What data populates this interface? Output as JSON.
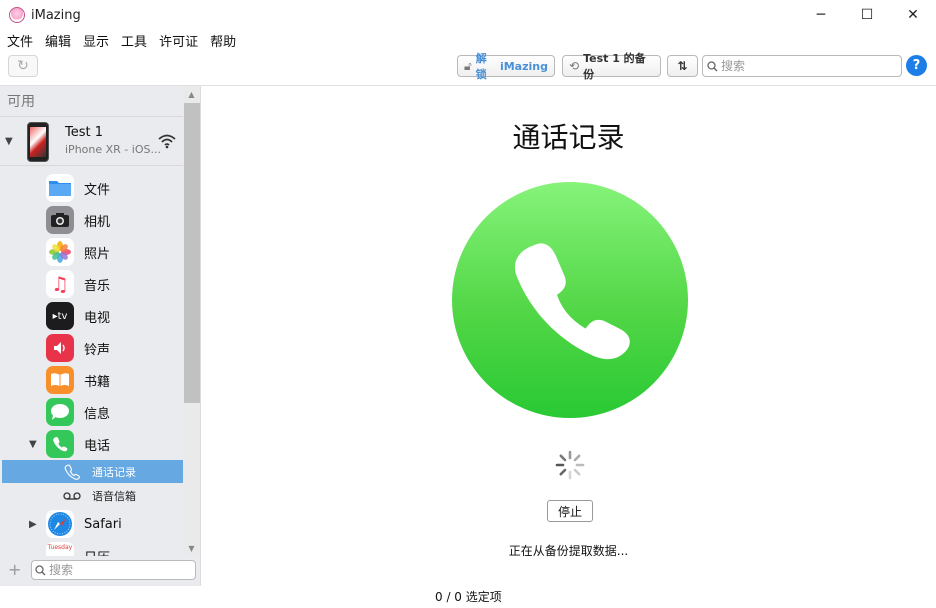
{
  "window": {
    "title": "iMazing"
  },
  "menu": [
    "文件",
    "编辑",
    "显示",
    "工具",
    "许可证",
    "帮助"
  ],
  "toolbar": {
    "unlock_prefix": "解锁",
    "unlock_brand": "iMazing",
    "backup_label": "Test 1 的备份",
    "search_placeholder": "搜索",
    "help_label": "?"
  },
  "sidebar": {
    "section_title": "可用",
    "device": {
      "name": "Test 1",
      "subtitle": "iPhone XR - iOS..."
    },
    "items": [
      {
        "label": "文件",
        "icon": "folder-icon",
        "color": "#2f8ff0"
      },
      {
        "label": "相机",
        "icon": "camera-icon",
        "color": "#8e8e93"
      },
      {
        "label": "照片",
        "icon": "photos-icon",
        "color": "#ffffff"
      },
      {
        "label": "音乐",
        "icon": "music-icon",
        "color": "#ffffff"
      },
      {
        "label": "电视",
        "icon": "tv-icon",
        "color": "#1c1c1e"
      },
      {
        "label": "铃声",
        "icon": "ringtone-icon",
        "color": "#e9334a"
      },
      {
        "label": "书籍",
        "icon": "books-icon",
        "color": "#f7902a"
      },
      {
        "label": "信息",
        "icon": "messages-icon",
        "color": "#34c759"
      },
      {
        "label": "电话",
        "icon": "phone-icon",
        "color": "#34c759"
      }
    ],
    "sub_items": [
      {
        "label": "通话记录",
        "selected": true
      },
      {
        "label": "语音信箱",
        "selected": false
      }
    ],
    "more_items": [
      {
        "label": "Safari",
        "icon": "safari-icon"
      },
      {
        "label": "日历",
        "icon": "calendar-icon"
      }
    ],
    "search_placeholder": "搜索",
    "calendar_day": "Tuesday"
  },
  "main": {
    "title": "通话记录",
    "stop_label": "停止",
    "status": "正在从备份提取数据..."
  },
  "status_bar": {
    "selection": "0 / 0 选定项"
  }
}
